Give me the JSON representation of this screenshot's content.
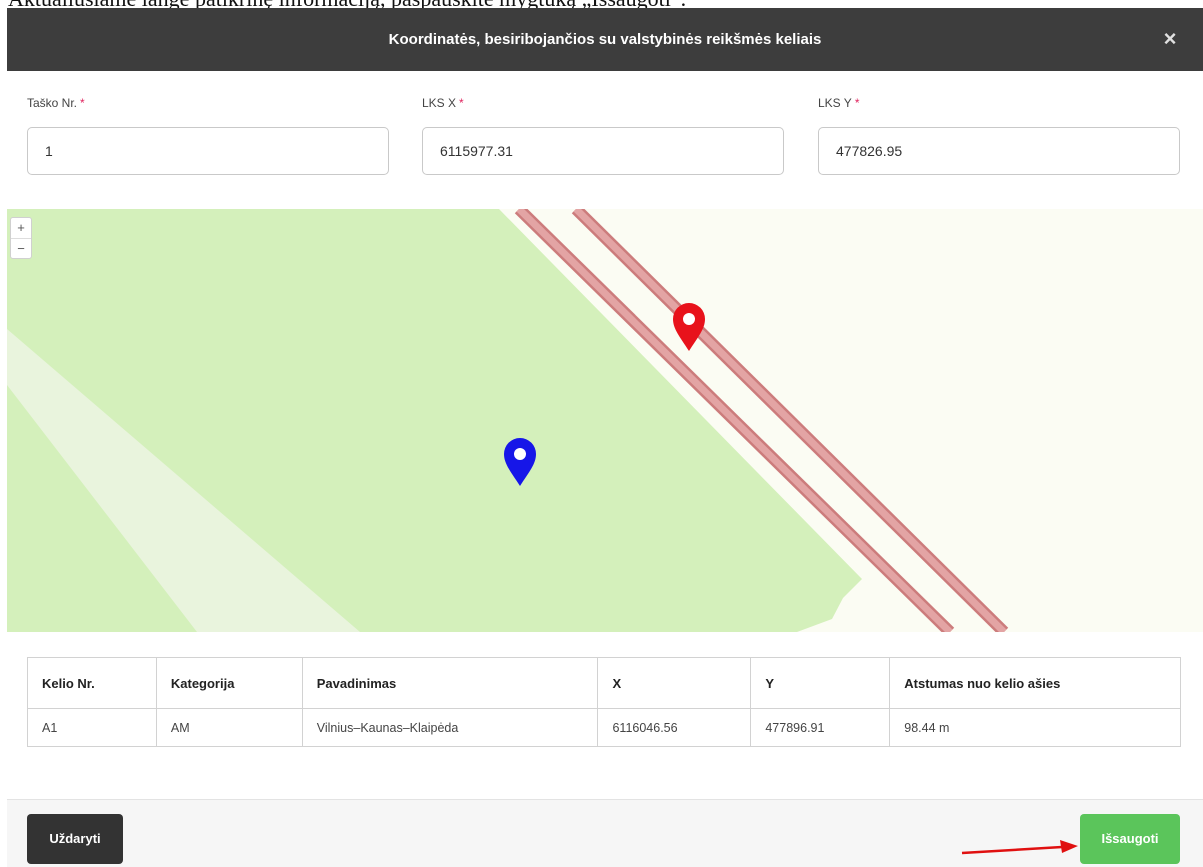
{
  "document": {
    "caption": "Aktualiuslame lange patikrinę informaciją, paspauskite mygtuką „Išsaugoti“."
  },
  "modal": {
    "title": "Koordinatės, besiribojančios su valstybinės reikšmės keliais",
    "close_glyph": "×"
  },
  "form": {
    "point_no": {
      "label": "Taško Nr.",
      "required": "*",
      "value": "1"
    },
    "lks_x": {
      "label": "LKS X",
      "required": "*",
      "value": "6115977.31"
    },
    "lks_y": {
      "label": "LKS Y",
      "required": "*",
      "value": "477826.95"
    }
  },
  "map": {
    "zoom_in": "+",
    "zoom_out": "−",
    "markers": [
      {
        "name": "road-point-marker",
        "color": "#e8121b"
      },
      {
        "name": "entered-point-marker",
        "color": "#1616e8"
      }
    ],
    "colors": {
      "background": "#fbfcf3",
      "parcel": "#d4f0bb",
      "strip": "#e9f4dd",
      "road_fill": "#e3a4a4",
      "road_edge": "#cc7c7c"
    }
  },
  "table": {
    "headers": [
      "Kelio Nr.",
      "Kategorija",
      "Pavadinimas",
      "X",
      "Y",
      "Atstumas nuo kelio ašies"
    ],
    "rows": [
      [
        "A1",
        "AM",
        "Vilnius–Kaunas–Klaipėda",
        "6116046.56",
        "477896.91",
        "98.44 m"
      ]
    ]
  },
  "footer": {
    "close_label": "Uždaryti",
    "save_label": "Išsaugoti"
  },
  "colors": {
    "header_bg": "#3d3d3d",
    "save_bg": "#5bc55b",
    "close_bg": "#333333",
    "required": "#e0245e",
    "annotation": "#e01010"
  }
}
